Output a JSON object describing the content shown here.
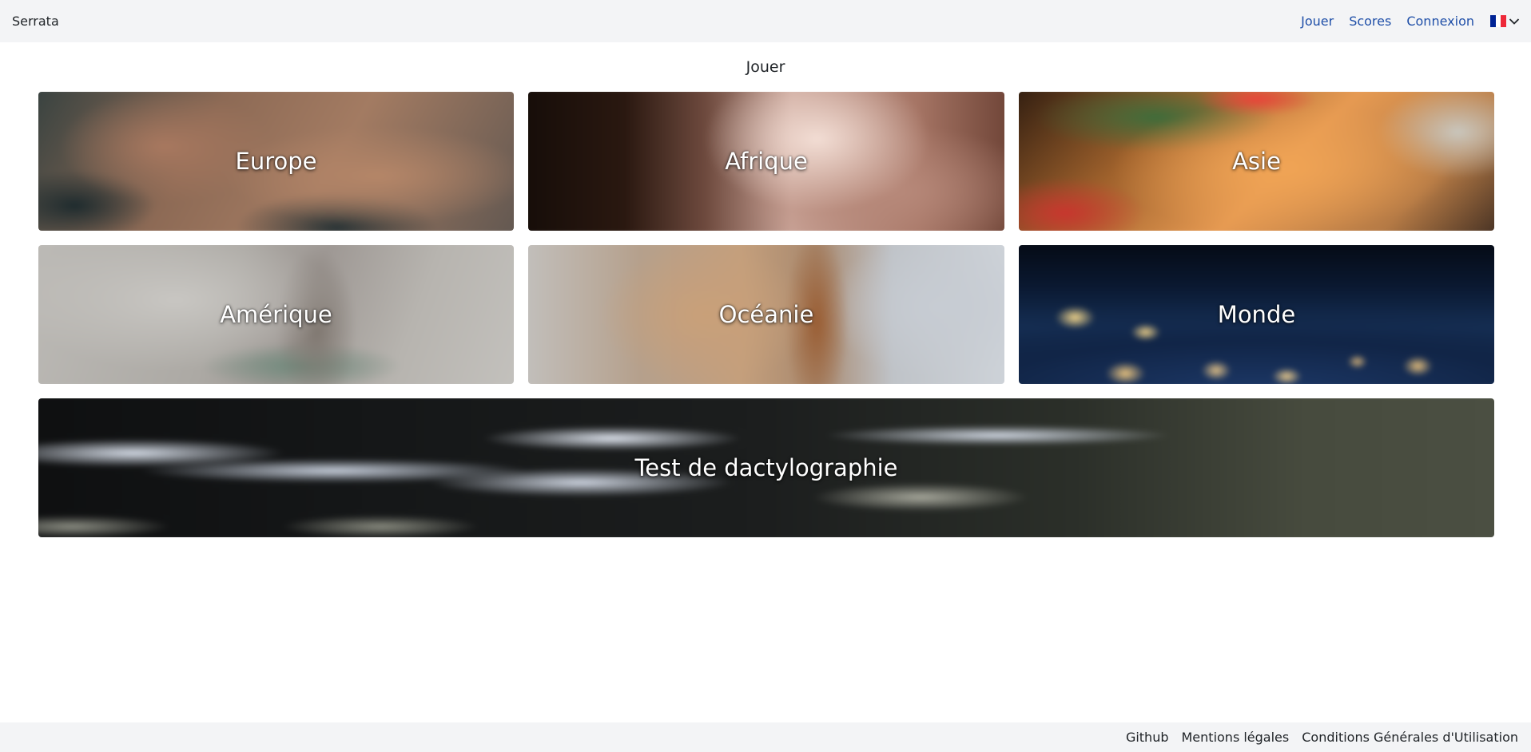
{
  "navbar": {
    "brand": "Serrata",
    "links": {
      "play": "Jouer",
      "scores": "Scores",
      "login": "Connexion"
    },
    "language": {
      "flag_colors": [
        "#002395",
        "#ffffff",
        "#ed2939"
      ]
    }
  },
  "main": {
    "title": "Jouer",
    "cards": {
      "europe": "Europe",
      "afrique": "Afrique",
      "asie": "Asie",
      "amerique": "Amérique",
      "oceanie": "Océanie",
      "monde": "Monde",
      "typing": "Test de dactylographie"
    }
  },
  "footer": {
    "github": "Github",
    "legal": "Mentions légales",
    "terms": "Conditions Générales d'Utilisation"
  },
  "colors": {
    "link": "#1f4fa8",
    "bar_bg": "#f3f4f6"
  }
}
